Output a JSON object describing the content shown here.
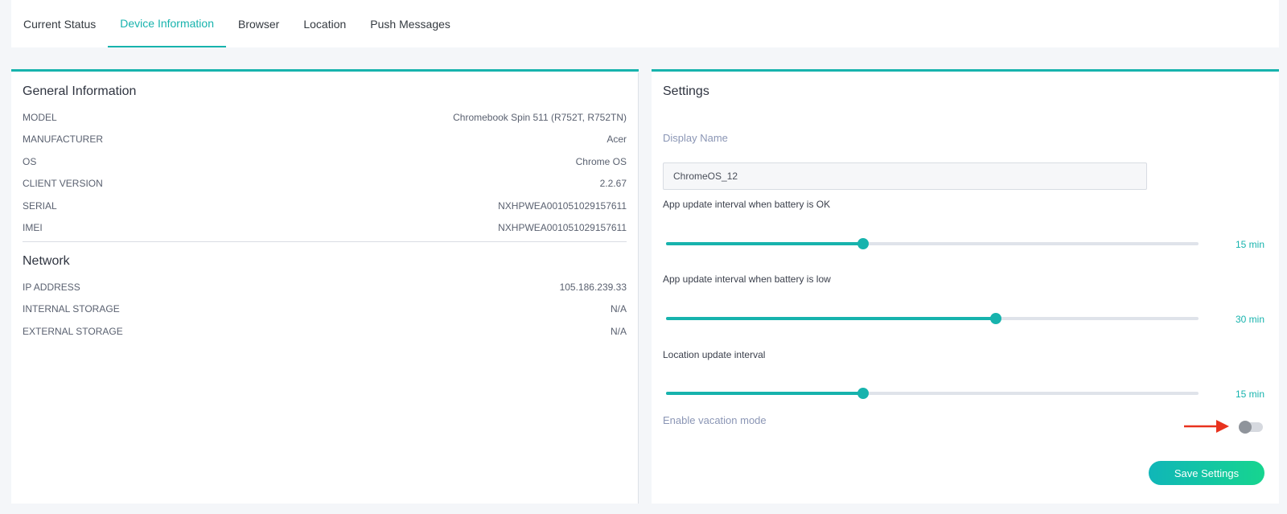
{
  "tabs": [
    {
      "label": "Current Status"
    },
    {
      "label": "Device Information"
    },
    {
      "label": "Browser"
    },
    {
      "label": "Location"
    },
    {
      "label": "Push Messages"
    }
  ],
  "general": {
    "title": "General Information",
    "rows": [
      {
        "key": "MODEL",
        "value": "Chromebook Spin 511 (R752T, R752TN)"
      },
      {
        "key": "MANUFACTURER",
        "value": "Acer"
      },
      {
        "key": "OS",
        "value": "Chrome OS"
      },
      {
        "key": "CLIENT VERSION",
        "value": "2.2.67"
      },
      {
        "key": "SERIAL",
        "value": "NXHPWEA001051029157611"
      },
      {
        "key": "IMEI",
        "value": "NXHPWEA001051029157611"
      }
    ]
  },
  "network": {
    "title": "Network",
    "rows": [
      {
        "key": "IP ADDRESS",
        "value": "105.186.239.33"
      },
      {
        "key": "INTERNAL STORAGE",
        "value": "N/A"
      },
      {
        "key": "EXTERNAL STORAGE",
        "value": "N/A"
      }
    ]
  },
  "settings": {
    "title": "Settings",
    "display_name_label": "Display Name",
    "display_name_value": "ChromeOS_12",
    "sliders": [
      {
        "label": "App update interval when battery is OK",
        "value": "15 min",
        "fraction": 0.37
      },
      {
        "label": "App update interval when battery is low",
        "value": "30 min",
        "fraction": 0.62
      },
      {
        "label": "Location update interval",
        "value": "15 min",
        "fraction": 0.37
      }
    ],
    "vacation_label": "Enable vacation mode",
    "vacation_enabled": false,
    "save_label": "Save Settings"
  },
  "colors": {
    "accent": "#17b3ad",
    "annotation_arrow": "#e8321e"
  }
}
